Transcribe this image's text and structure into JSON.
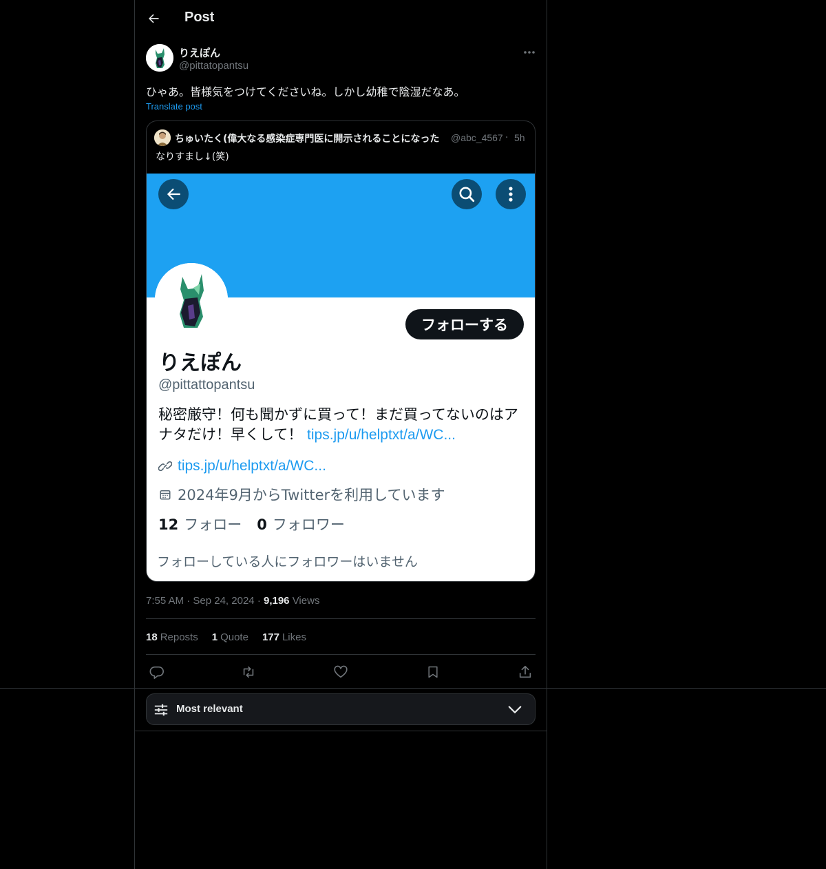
{
  "header": {
    "title": "Post"
  },
  "post": {
    "author_name": "りえぽん",
    "author_handle": "@pittatopantsu",
    "text": "ひゃあ。皆様気をつけてくださいね。しかし幼稚で陰湿だなあ。",
    "translate_label": "Translate post",
    "time": "7:55 AM",
    "date": "Sep 24, 2024",
    "views_count": "9,196",
    "views_label": "Views"
  },
  "quote": {
    "author_name": "ちゅいたく(偉大なる感染症専門医に開示されることになった",
    "author_handle": "@abc_4567",
    "time": "5h",
    "text": "なりすまし↓(笑)",
    "screenshot": {
      "name": "りえぽん",
      "handle": "@pittattopantsu",
      "follow_label": "フォローする",
      "bio_text": "秘密厳守！何も聞かずに買って！まだ買ってないのはアナタだけ！早くして！ ",
      "bio_link": "tips.jp/u/helptxt/a/WC...",
      "url": "tips.jp/u/helptxt/a/WC...",
      "joined": "2024年9月からTwitterを利用しています",
      "following_count": "12",
      "following_label": "フォロー",
      "followers_count": "0",
      "followers_label": "フォロワー",
      "no_followers_note": "フォローしている人にフォロワーはいません",
      "banner_color": "#1da1f2"
    }
  },
  "stats": {
    "reposts_count": "18",
    "reposts_label": "Reposts",
    "quotes_count": "1",
    "quotes_label": "Quote",
    "likes_count": "177",
    "likes_label": "Likes"
  },
  "actions": [
    "reply-icon",
    "repost-icon",
    "like-icon",
    "bookmark-icon",
    "share-icon"
  ],
  "sort": {
    "label": "Most relevant"
  },
  "colors": {
    "accent": "#1d9bf0",
    "background": "#000000",
    "border": "#2f3336",
    "muted": "#71767b"
  }
}
